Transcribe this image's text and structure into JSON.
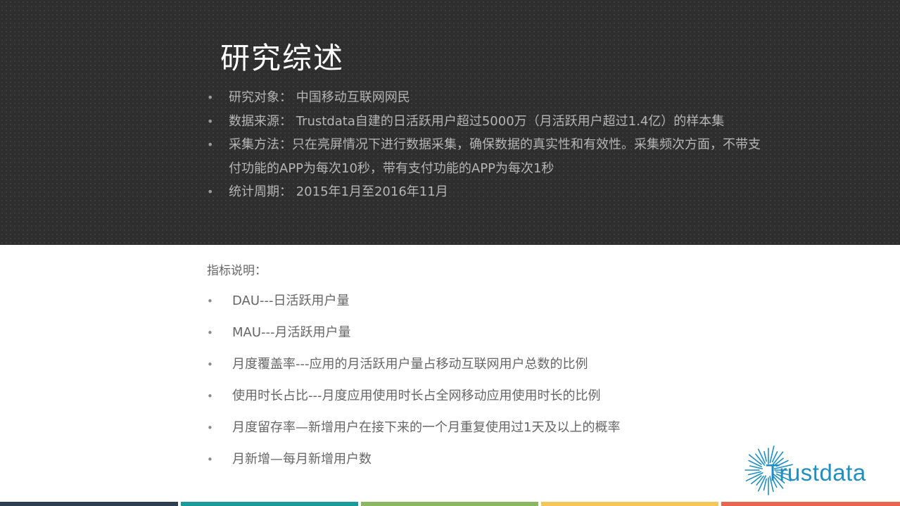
{
  "header": {
    "title": "研究综述",
    "items": [
      "研究对象： 中国移动互联网网民",
      "数据来源： Trustdata自建的日活跃用户超过5000万（月活跃用户超过1.4亿）的样本集",
      "采集方法：只在亮屏情况下进行数据采集，确保数据的真实性和有效性。采集频次方面，不带支付功能的APP为每次10秒，带有支付功能的APP为每次1秒",
      "统计周期： 2015年1月至2016年11月"
    ]
  },
  "metrics": {
    "label": "指标说明：",
    "items": [
      "DAU---日活跃用户量",
      "MAU---月活跃用户量",
      "月度覆盖率---应用的月活跃用户量占移动互联网用户总数的比例",
      "使用时长占比---月度应用使用时长占全网移动应用使用时长的比例",
      "月度留存率—新增用户在接下来的一个月重复使用过1天及以上的概率",
      "月新增—每月新增用户数"
    ]
  },
  "bullet": "•",
  "logo": {
    "text": "Trustdata",
    "icon": "sunburst-logo-icon",
    "color": "#1f8fc4"
  },
  "footer_colors": [
    "#2d3e50",
    "#1a9a9b",
    "#8bb85e",
    "#f7c65b",
    "#e8664d"
  ]
}
